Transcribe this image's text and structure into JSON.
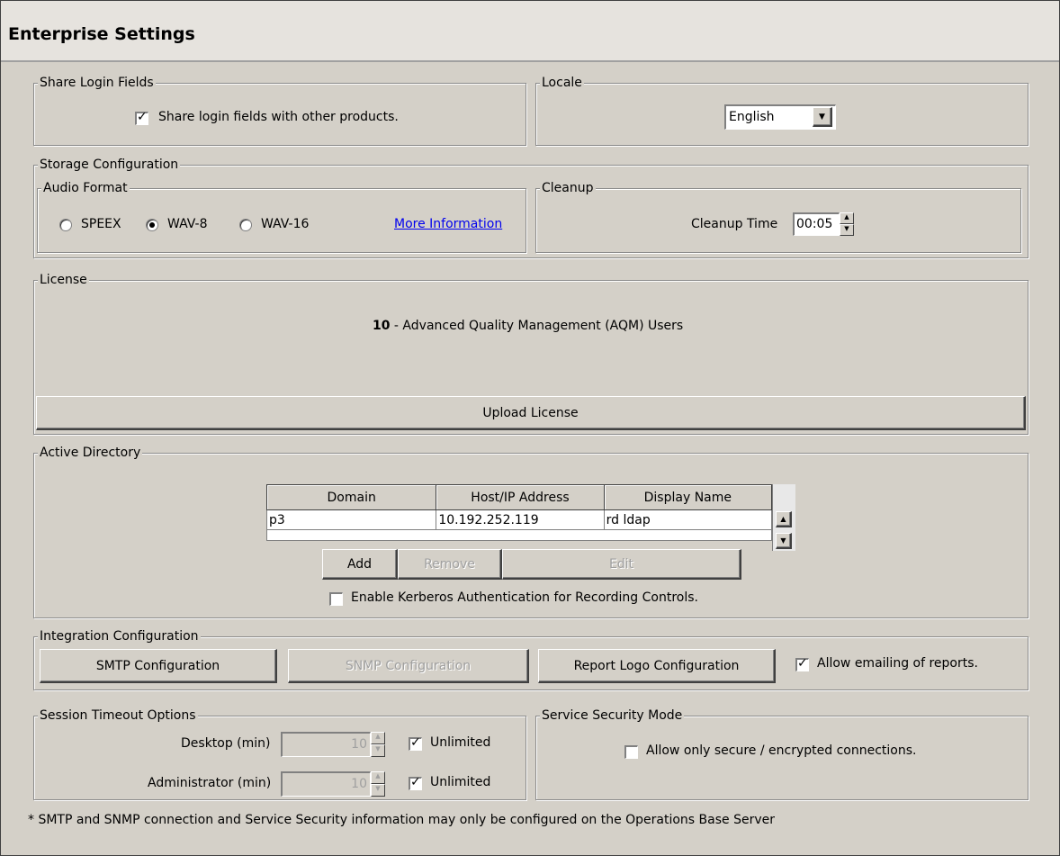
{
  "window": {
    "title": "Enterprise Settings"
  },
  "share_login": {
    "legend": "Share Login Fields",
    "checkbox_label": "Share login fields with other products.",
    "checked": true
  },
  "locale": {
    "legend": "Locale",
    "selected": "English"
  },
  "storage": {
    "legend": "Storage Configuration",
    "audio_format": {
      "legend": "Audio Format",
      "options": [
        "SPEEX",
        "WAV-8",
        "WAV-16"
      ],
      "selected": "WAV-8",
      "more_info_link": "More Information"
    },
    "cleanup": {
      "legend": "Cleanup",
      "label": "Cleanup Time",
      "value": "00:05"
    }
  },
  "license": {
    "legend": "License",
    "count": "10",
    "description": " - Advanced Quality Management (AQM) Users",
    "upload_button": "Upload License"
  },
  "active_directory": {
    "legend": "Active Directory",
    "columns": [
      "Domain",
      "Host/IP Address",
      "Display Name"
    ],
    "rows": [
      [
        "p3",
        "10.192.252.119",
        "rd ldap"
      ]
    ],
    "add_button": "Add",
    "remove_button": "Remove",
    "edit_button": "Edit",
    "kerberos_label": "Enable Kerberos Authentication for Recording Controls.",
    "kerberos_checked": false
  },
  "integration": {
    "legend": "Integration Configuration",
    "smtp_button": "SMTP Configuration",
    "snmp_button": "SNMP Configuration",
    "report_logo_button": "Report Logo Configuration",
    "allow_email_label": "Allow emailing of reports.",
    "allow_email_checked": true
  },
  "session_timeout": {
    "legend": "Session Timeout Options",
    "desktop_label": "Desktop (min)",
    "desktop_value": "10",
    "desktop_unlimited_label": "Unlimited",
    "admin_label": "Administrator (min)",
    "admin_value": "10",
    "admin_unlimited_label": "Unlimited"
  },
  "service_security": {
    "legend": "Service Security Mode",
    "checkbox_label": "Allow only secure / encrypted connections.",
    "checked": false
  },
  "footer_note": "* SMTP and SNMP connection and Service Security information may only be configured on the Operations Base Server"
}
